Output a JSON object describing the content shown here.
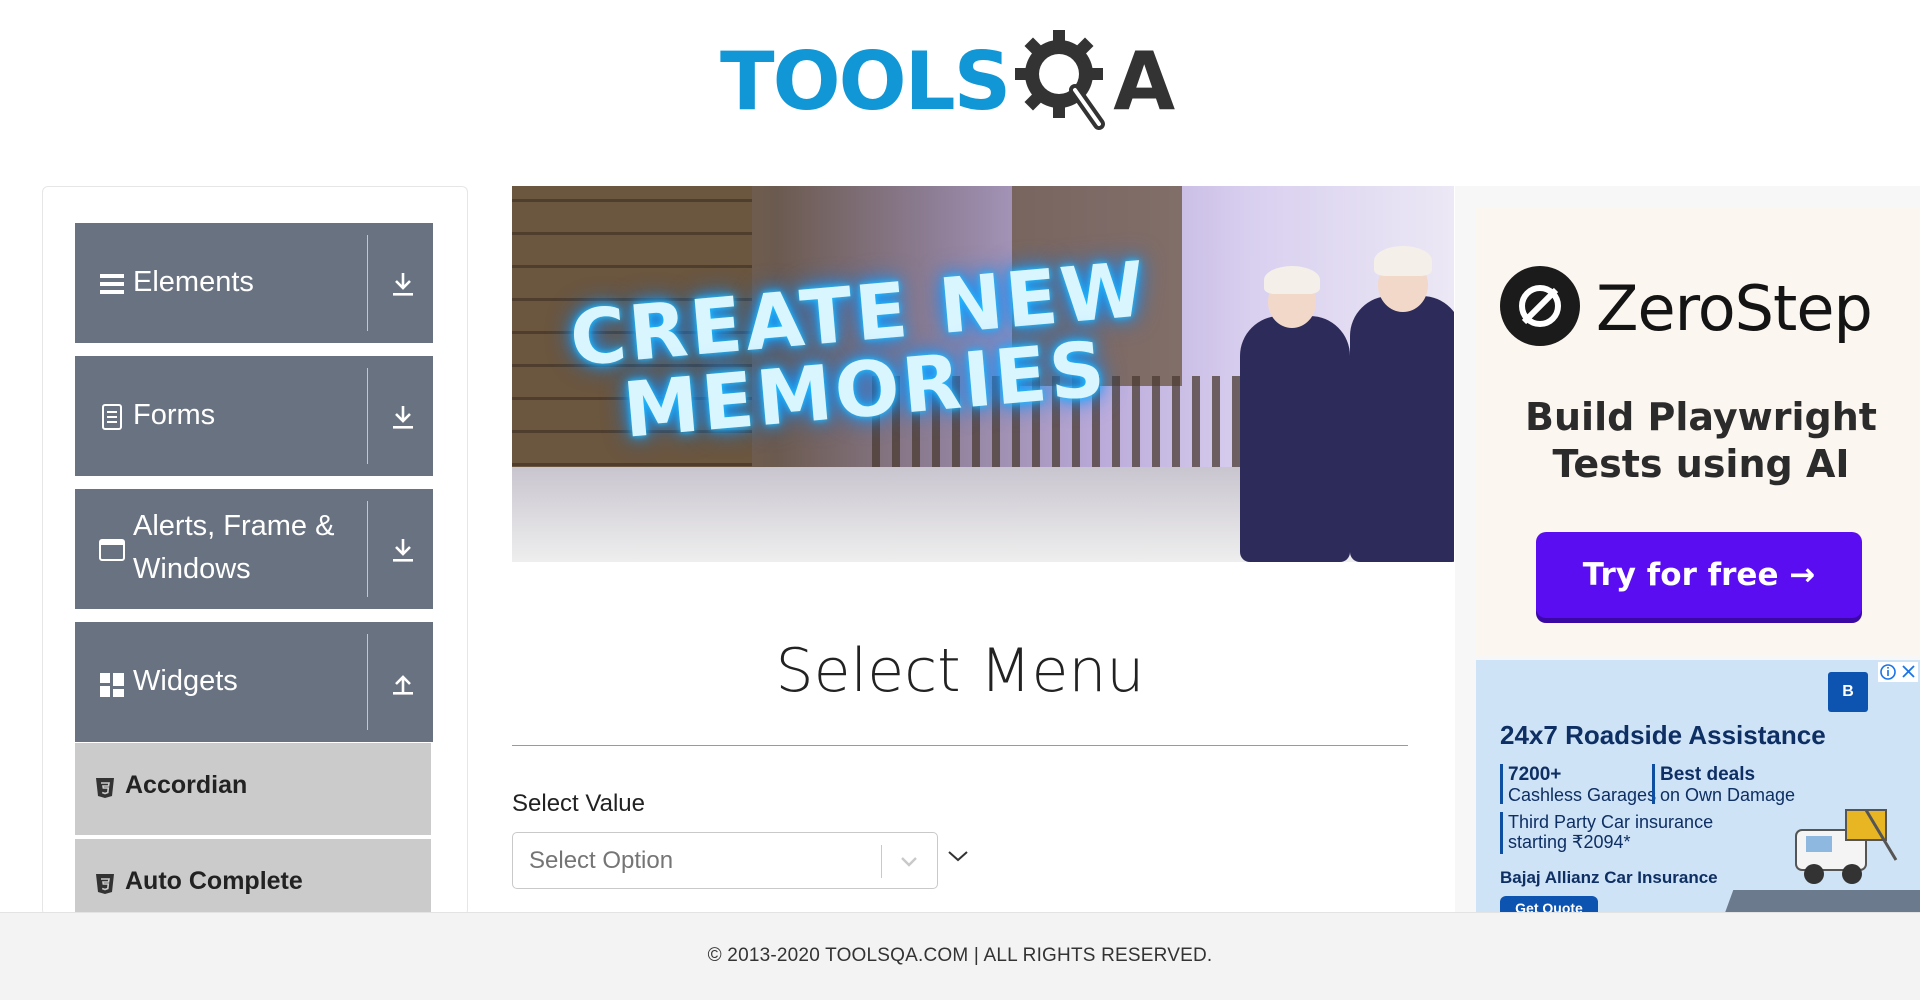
{
  "header": {
    "logo_text_tools": "TOOLS",
    "logo_text_a": "A"
  },
  "sidebar": {
    "groups": [
      {
        "label": "Elements",
        "icon": "hamburger-icon",
        "expanded": false
      },
      {
        "label": "Forms",
        "icon": "document-icon",
        "expanded": false
      },
      {
        "label": "Alerts, Frame &",
        "label_line2": "Windows",
        "icon": "window-icon",
        "expanded": false
      },
      {
        "label": "Widgets",
        "icon": "widgets-icon",
        "expanded": true
      }
    ],
    "widget_items": [
      {
        "label": "Accordian",
        "icon": "html5-icon"
      },
      {
        "label": "Auto Complete",
        "icon": "html5-icon"
      }
    ]
  },
  "banner": {
    "headline_line1": "CREATE NEW",
    "headline_line2": "MEMORIES"
  },
  "main": {
    "title": "Select Menu",
    "select_value_label": "Select Value",
    "select_value_placeholder": "Select Option"
  },
  "ads": {
    "zerostep": {
      "brand": "ZeroStep",
      "headline_line1": "Build Playwright",
      "headline_line2": "Tests using AI",
      "cta": "Try for free →"
    },
    "bajaj": {
      "headline": "24x7 Roadside Assistance",
      "stat1_value": "7200+",
      "stat1_label": "Cashless Garages",
      "stat2_value": "Best deals",
      "stat2_label": "on Own Damage",
      "stat3_line1": "Third Party Car insurance",
      "stat3_line2": "starting ₹2094*",
      "brand_line": "Bajaj Allianz Car Insurance",
      "cta": "Get Quote",
      "logo": "B"
    }
  },
  "footer": {
    "copyright": "© 2013-2020 TOOLSQA.COM | ALL RIGHTS RESERVED."
  },
  "colors": {
    "nav_group_bg": "#697280",
    "nav_sub_bg": "#cbcbcb",
    "brand_blue": "#1197d6",
    "cta_purple": "#5a0df0"
  }
}
